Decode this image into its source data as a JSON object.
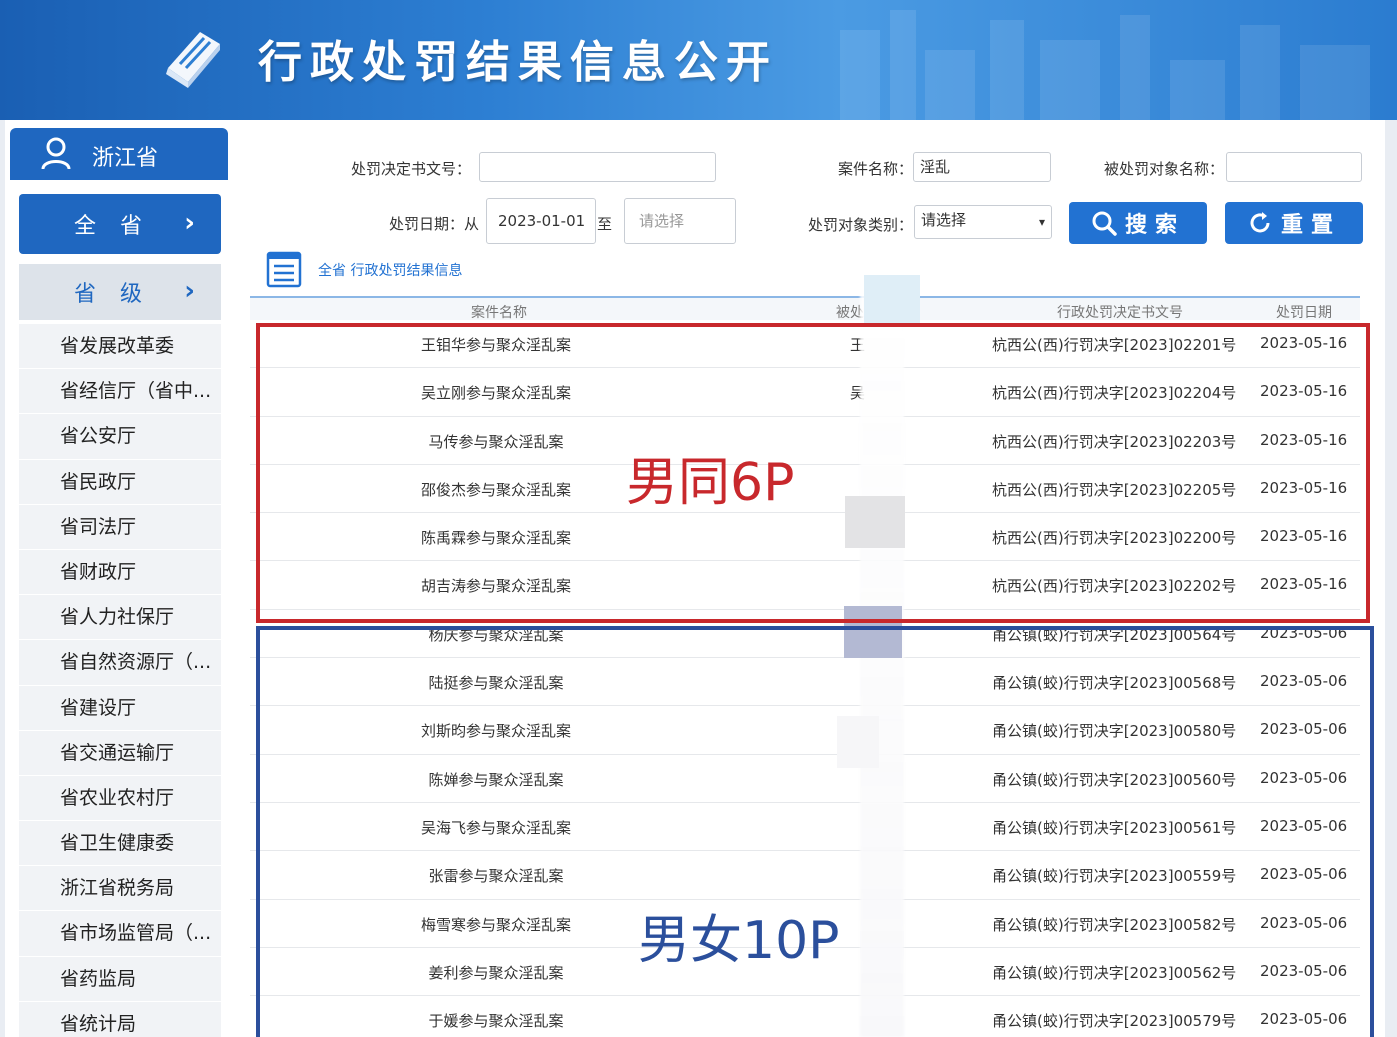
{
  "banner": {
    "title": "行政处罚结果信息公开"
  },
  "sidebar": {
    "region": "浙江省",
    "all_button": "全省",
    "level_button": "省级",
    "chevron": "›",
    "departments": [
      "省发展改革委",
      "省经信厅（省中...",
      "省公安厅",
      "省民政厅",
      "省司法厅",
      "省财政厅",
      "省人力社保厅",
      "省自然资源厅（...",
      "省建设厅",
      "省交通运输厅",
      "省农业农村厅",
      "省卫生健康委",
      "浙江省税务局",
      "省市场监管局（...",
      "省药监局",
      "省统计局"
    ]
  },
  "search": {
    "doc_no_label": "处罚决定书文号：",
    "doc_no_value": "",
    "case_name_label": "案件名称：",
    "case_name_value": "淫乱",
    "target_name_label": "被处罚对象名称：",
    "target_name_value": "",
    "date_label": "处罚日期：从",
    "date_from": "2023-01-01",
    "date_to_label": "至",
    "date_to_placeholder": "请选择",
    "target_type_label": "处罚对象类别：",
    "target_type_value": "请选择",
    "search_button": "搜索",
    "reset_button": "重置"
  },
  "section": {
    "title": "全省 行政处罚结果信息"
  },
  "table": {
    "headers": {
      "name": "案件名称",
      "target": "被处",
      "doc": "行政处罚决定书文号",
      "date": "处罚日期"
    },
    "rows": [
      {
        "name": "王钼华参与聚众淫乱案",
        "target": "王",
        "doc": "杭西公(西)行罚决字[2023]02201号",
        "date": "2023-05-16"
      },
      {
        "name": "吴立刚参与聚众淫乱案",
        "target": "吴",
        "doc": "杭西公(西)行罚决字[2023]02204号",
        "date": "2023-05-16"
      },
      {
        "name": "马传参与聚众淫乱案",
        "target": "",
        "doc": "杭西公(西)行罚决字[2023]02203号",
        "date": "2023-05-16"
      },
      {
        "name": "邵俊杰参与聚众淫乱案",
        "target": "",
        "doc": "杭西公(西)行罚决字[2023]02205号",
        "date": "2023-05-16"
      },
      {
        "name": "陈禹霖参与聚众淫乱案",
        "target": "",
        "doc": "杭西公(西)行罚决字[2023]02200号",
        "date": "2023-05-16"
      },
      {
        "name": "胡吉涛参与聚众淫乱案",
        "target": "",
        "doc": "杭西公(西)行罚决字[2023]02202号",
        "date": "2023-05-16"
      },
      {
        "name": "杨庆参与聚众淫乱案",
        "target": "",
        "doc": "甬公镇(蛟)行罚决字[2023]00564号",
        "date": "2023-05-06"
      },
      {
        "name": "陆挺参与聚众淫乱案",
        "target": "",
        "doc": "甬公镇(蛟)行罚决字[2023]00568号",
        "date": "2023-05-06"
      },
      {
        "name": "刘斯昀参与聚众淫乱案",
        "target": "",
        "doc": "甬公镇(蛟)行罚决字[2023]00580号",
        "date": "2023-05-06"
      },
      {
        "name": "陈婵参与聚众淫乱案",
        "target": "",
        "doc": "甬公镇(蛟)行罚决字[2023]00560号",
        "date": "2023-05-06"
      },
      {
        "name": "吴海飞参与聚众淫乱案",
        "target": "",
        "doc": "甬公镇(蛟)行罚决字[2023]00561号",
        "date": "2023-05-06"
      },
      {
        "name": "张雷参与聚众淫乱案",
        "target": "",
        "doc": "甬公镇(蛟)行罚决字[2023]00559号",
        "date": "2023-05-06"
      },
      {
        "name": "梅雪寒参与聚众淫乱案",
        "target": "",
        "doc": "甬公镇(蛟)行罚决字[2023]00582号",
        "date": "2023-05-06"
      },
      {
        "name": "姜利参与聚众淫乱案",
        "target": "",
        "doc": "甬公镇(蛟)行罚决字[2023]00562号",
        "date": "2023-05-06"
      },
      {
        "name": "于媛参与聚众淫乱案",
        "target": "",
        "doc": "甬公镇(蛟)行罚决字[2023]00579号",
        "date": "2023-05-06"
      }
    ]
  },
  "annotations": {
    "red": "男同6P",
    "blue": "男女10P"
  },
  "colors": {
    "primary": "#1f67c0",
    "button": "#2272d2",
    "red_box": "#c8282c",
    "blue_box": "#2b4f9c"
  }
}
